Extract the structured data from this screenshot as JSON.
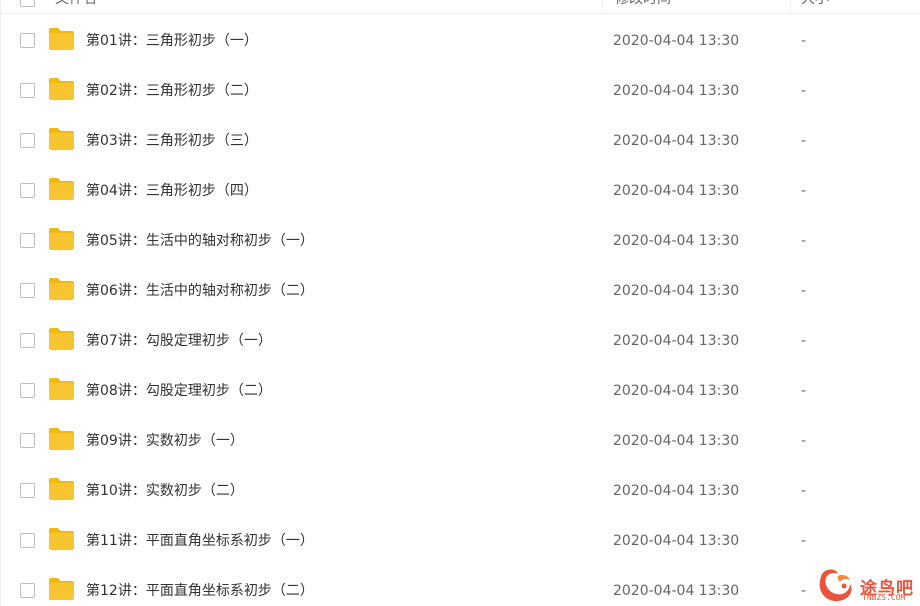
{
  "header": {
    "name_label": "文件名",
    "time_label": "修改时间",
    "size_label": "大小"
  },
  "files": [
    {
      "name": "第01讲：三角形初步（一）",
      "modified": "2020-04-04 13:30",
      "size": "-"
    },
    {
      "name": "第02讲：三角形初步（二）",
      "modified": "2020-04-04 13:30",
      "size": "-"
    },
    {
      "name": "第03讲：三角形初步（三）",
      "modified": "2020-04-04 13:30",
      "size": "-"
    },
    {
      "name": "第04讲：三角形初步（四）",
      "modified": "2020-04-04 13:30",
      "size": "-"
    },
    {
      "name": "第05讲：生活中的轴对称初步（一）",
      "modified": "2020-04-04 13:30",
      "size": "-"
    },
    {
      "name": "第06讲：生活中的轴对称初步（二）",
      "modified": "2020-04-04 13:30",
      "size": "-"
    },
    {
      "name": "第07讲：勾股定理初步（一）",
      "modified": "2020-04-04 13:30",
      "size": "-"
    },
    {
      "name": "第08讲：勾股定理初步（二）",
      "modified": "2020-04-04 13:30",
      "size": "-"
    },
    {
      "name": "第09讲：实数初步（一）",
      "modified": "2020-04-04 13:30",
      "size": "-"
    },
    {
      "name": "第10讲：实数初步（二）",
      "modified": "2020-04-04 13:30",
      "size": "-"
    },
    {
      "name": "第11讲：平面直角坐标系初步（一）",
      "modified": "2020-04-04 13:30",
      "size": "-"
    },
    {
      "name": "第12讲：平面直角坐标系初步（二）",
      "modified": "2020-04-04 13:30",
      "size": "-"
    }
  ],
  "watermark": {
    "text": "途鸟吧",
    "subtext": "TNBZS.COM"
  },
  "colors": {
    "folder": "#f7c531",
    "folder_tab": "#f0b90f",
    "watermark": "#e8553a"
  },
  "icons": {
    "folder": "folder-icon",
    "checkbox": "checkbox",
    "sort": "sort-arrow-down-icon"
  }
}
